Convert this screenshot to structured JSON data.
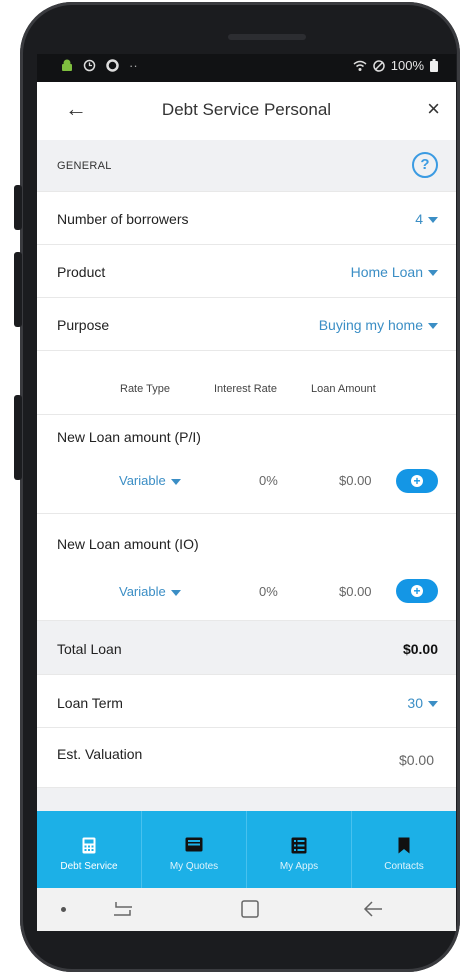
{
  "status_bar": {
    "battery": "100%"
  },
  "header": {
    "title": "Debt Service Personal"
  },
  "general": {
    "section_label": "GENERAL",
    "help_glyph": "?",
    "borrowers": {
      "label": "Number of borrowers",
      "value": "4"
    },
    "product": {
      "label": "Product",
      "value": "Home Loan"
    },
    "purpose": {
      "label": "Purpose",
      "value": "Buying my home"
    }
  },
  "columns": {
    "rate_type": "Rate Type",
    "interest_rate": "Interest Rate",
    "loan_amount": "Loan Amount"
  },
  "loans": [
    {
      "title": "New Loan amount (P/I)",
      "rate_type": "Variable",
      "interest_rate": "0%",
      "amount": "$0.00"
    },
    {
      "title": "New Loan amount (IO)",
      "rate_type": "Variable",
      "interest_rate": "0%",
      "amount": "$0.00"
    }
  ],
  "totals": {
    "total_loan": {
      "label": "Total Loan",
      "value": "$0.00"
    },
    "loan_term": {
      "label": "Loan Term",
      "value": "30"
    },
    "valuation": {
      "label": "Est. Valuation",
      "value": "$0.00"
    }
  },
  "tabs": [
    {
      "label": "Debt Service",
      "icon": "calculator-icon",
      "active": true
    },
    {
      "label": "My Quotes",
      "icon": "inbox-icon",
      "active": false
    },
    {
      "label": "My Apps",
      "icon": "list-icon",
      "active": false
    },
    {
      "label": "Contacts",
      "icon": "bookmark-icon",
      "active": false
    }
  ],
  "colors": {
    "accent": "#3b8ec5",
    "tab_bar": "#1cb0e7",
    "add_button": "#1496e5",
    "help": "#3b9be2"
  }
}
